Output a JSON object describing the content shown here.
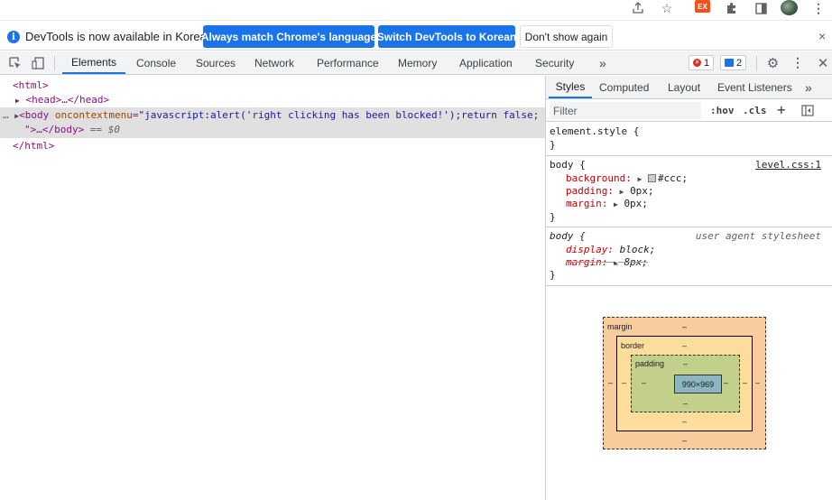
{
  "infobar": {
    "message": "DevTools is now available in Korean!",
    "btn_match_language": "Always match Chrome's language",
    "btn_switch_korean": "Switch DevTools to Korean",
    "btn_dont_show": "Don't show again",
    "close": "×"
  },
  "toolbar": {
    "ext_badge": "EX",
    "overflow": "⋮"
  },
  "tabs": {
    "elements": "Elements",
    "console": "Console",
    "sources": "Sources",
    "network": "Network",
    "performance": "Performance",
    "memory": "Memory",
    "application": "Application",
    "security": "Security",
    "more": "»",
    "error_count": "1",
    "message_count": "2"
  },
  "dom": {
    "html_open": "<html>",
    "head": "<head>…</head>",
    "body_tag_open": "<body",
    "body_attr_name": "oncontextmenu",
    "body_attr_value": "\"javascript:alert('right clicking has been blocked!');return false;",
    "body_line2": "\">…</body>",
    "body_ref": "== $0",
    "html_close": "</html>",
    "ellipsis": "…"
  },
  "styles": {
    "subtabs": {
      "styles": "Styles",
      "computed": "Computed",
      "layout": "Layout",
      "event_listeners": "Event Listeners",
      "more": "»"
    },
    "filter_placeholder": "Filter",
    "hov": ":hov",
    "cls": ".cls",
    "plus": "+",
    "element_style_selector": "element.style {",
    "close_brace": "}",
    "rule1": {
      "selector": "body {",
      "source": "level.css:1",
      "background_prop": "background:",
      "background_val": "#ccc;",
      "padding_prop": "padding:",
      "padding_val": "0px;",
      "margin_prop": "margin:",
      "margin_val": "0px;"
    },
    "rule2": {
      "selector": "body {",
      "source": "user agent stylesheet",
      "display_prop": "display:",
      "display_val": "block;",
      "margin_prop": "margin:",
      "margin_val": "8px;"
    }
  },
  "box_model": {
    "margin_label": "margin",
    "border_label": "border",
    "padding_label": "padding",
    "content_size": "990×969",
    "dash": "–"
  },
  "colors": {
    "accent": "#1a73e8",
    "margin_box": "#f9cc9d",
    "border_box": "#fddd9b",
    "padding_box": "#c3d08b",
    "content_box": "#8cb6c0"
  }
}
